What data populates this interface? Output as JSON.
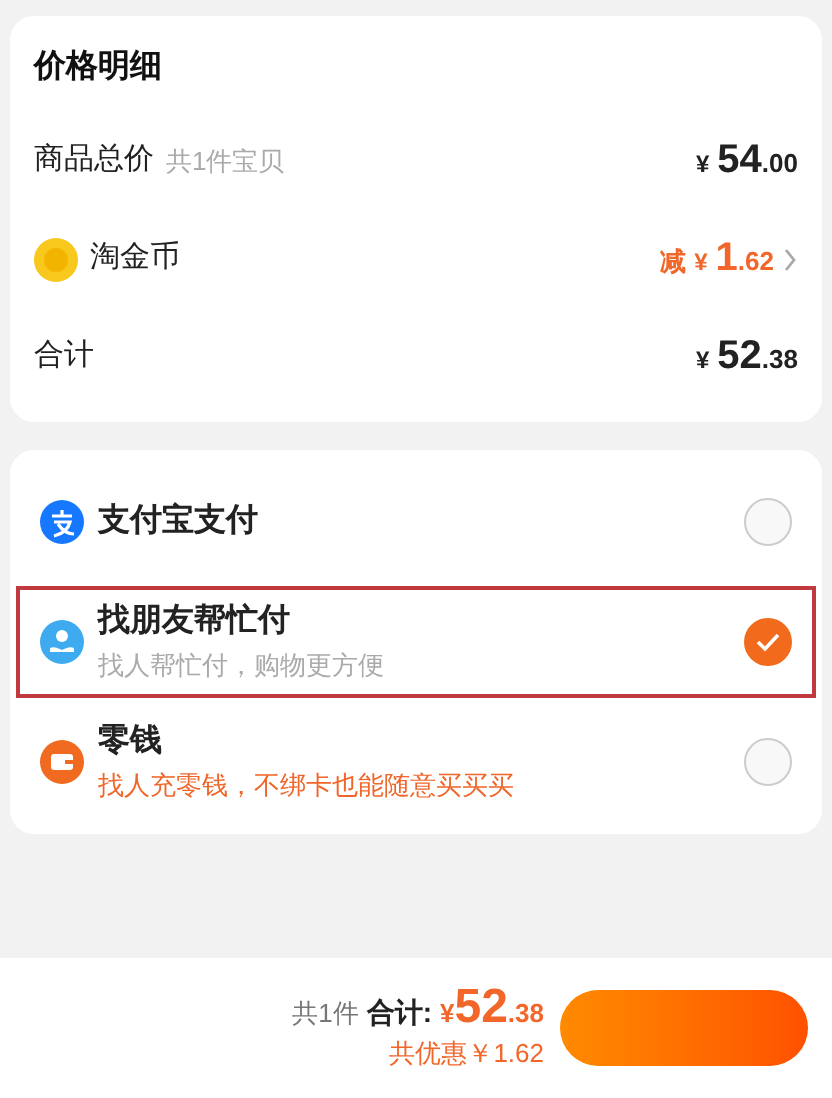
{
  "price_details": {
    "title": "价格明细",
    "rows": [
      {
        "kind": "plain",
        "label": "商品总价",
        "note": "共1件宝贝",
        "price": {
          "currency": "¥",
          "integer": "54",
          "decimal": ".00"
        }
      },
      {
        "kind": "coin",
        "label": "淘金币",
        "price": {
          "prefix": "减",
          "currency": "¥",
          "integer": "1",
          "decimal": ".62"
        },
        "discount": true,
        "chevron": true
      },
      {
        "kind": "plain",
        "label": "合计",
        "price": {
          "currency": "¥",
          "integer": "52",
          "decimal": ".38"
        }
      }
    ]
  },
  "payment_methods": [
    {
      "kind": "alipay",
      "name": "支付宝支付",
      "selected": false,
      "highlighted": false
    },
    {
      "kind": "friend",
      "name": "找朋友帮忙付",
      "subtitle": "找人帮忙付，购物更方便",
      "subtitle_emphasis": false,
      "selected": true,
      "highlighted": true
    },
    {
      "kind": "wallet",
      "name": "零钱",
      "subtitle": "找人充零钱，不绑卡也能随意买买买",
      "subtitle_emphasis": true,
      "selected": false,
      "highlighted": false
    }
  ],
  "footer": {
    "count": "共1件",
    "total_label": "合计:",
    "currency": "¥",
    "integer": "52",
    "decimal": ".38",
    "savings": "共优惠￥1.62"
  }
}
